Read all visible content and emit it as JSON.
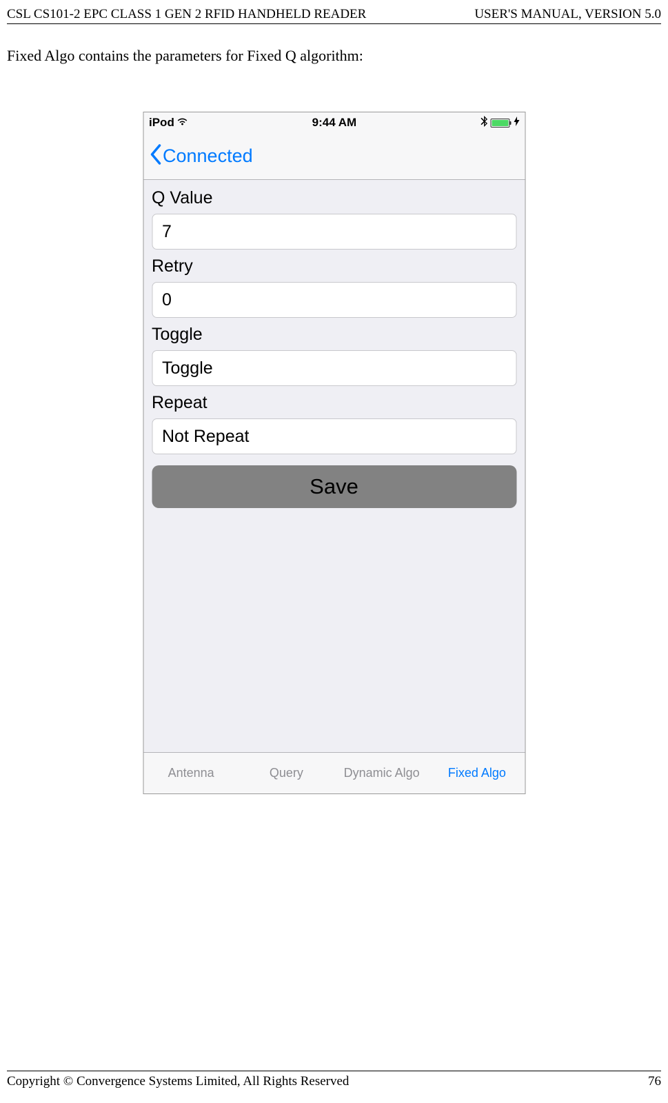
{
  "doc": {
    "header_left": "CSL CS101-2 EPC CLASS 1 GEN 2 RFID HANDHELD READER",
    "header_right": "USER'S  MANUAL,   VERSION  5.0",
    "body_text": "Fixed Algo contains the parameters for Fixed Q algorithm:",
    "footer_left": "Copyright © Convergence Systems Limited, All Rights Reserved",
    "footer_right": "76"
  },
  "statusbar": {
    "carrier": "iPod",
    "time": "9:44 AM"
  },
  "navbar": {
    "back_label": "Connected"
  },
  "form": {
    "q_value": {
      "label": "Q Value",
      "value": "7"
    },
    "retry": {
      "label": "Retry",
      "value": "0"
    },
    "toggle": {
      "label": "Toggle",
      "value": "Toggle"
    },
    "repeat": {
      "label": "Repeat",
      "value": "Not Repeat"
    },
    "save_label": "Save"
  },
  "tabs": {
    "antenna": "Antenna",
    "query": "Query",
    "dynamic": "Dynamic Algo",
    "fixed": "Fixed Algo"
  }
}
